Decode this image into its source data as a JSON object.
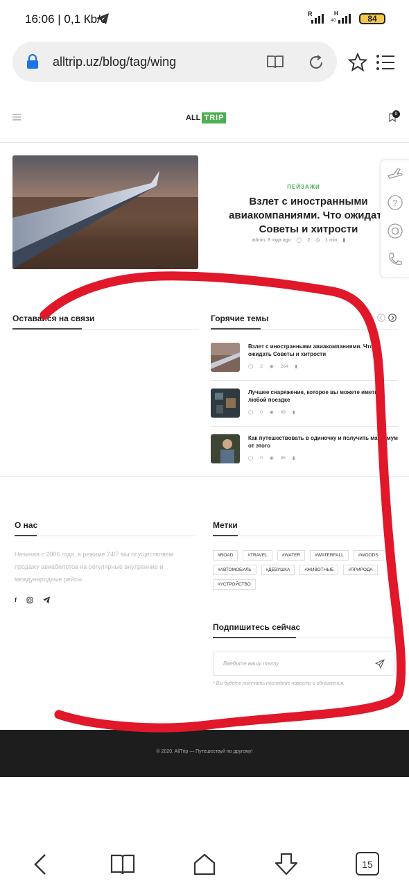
{
  "status": {
    "time": "16:06",
    "speed": "0,1 Кb/с",
    "battery": "84",
    "sim1": "R",
    "sim2": "H",
    "sim2_sub": "4G"
  },
  "browser": {
    "url": "alltrip.uz/blog/tag/wing",
    "tabs_count": "15"
  },
  "site": {
    "logo_all": "ALL",
    "logo_trip": "TRIP",
    "bookmark_count": "0",
    "featured": {
      "category": "ПЕЙЗАЖИ",
      "title": "Взлет с иностранными авиакомпаниями. Что ожидать Советы и хитрости",
      "author_time": "admin, 8 года ago",
      "comments": "2",
      "read_time": "1 min"
    },
    "keep_in_touch": "Оставайся на связи",
    "hot_topics": {
      "title": "Горячие темы",
      "posts": [
        {
          "title": "Взлет с иностранными авиакомпаниями. Что ожидать Советы и хитрости",
          "comments": "2",
          "views": "264"
        },
        {
          "title": "Лучшее снаряжение, которое вы можете иметь в любой поездке",
          "comments": "0",
          "views": "89"
        },
        {
          "title": "Как путешествовать в одиночку и получить максимум от этого",
          "comments": "0",
          "views": "95"
        }
      ]
    },
    "about": {
      "title": "О нас",
      "text": "Начиная с 2006 года, в режиме 24/7 мы осуществляем продажу авиабилетов на регулярные внутренние и международные рейсы."
    },
    "tags_title": "Метки",
    "tags": [
      "#ROAD",
      "#TRAVEL",
      "#WATER",
      "#WATERFALL",
      "#WOODS",
      "#АВТОМОБИЛЬ",
      "#ДЕВУШКА",
      "#ЖИВОТНЫЕ",
      "#ПРИРОДА",
      "#УСТРОЙСТВО"
    ],
    "subscribe": {
      "title": "Подпишитесь сейчас",
      "placeholder": "Введите вашу почту",
      "note": "* Вы будете получать последние новости и обновления."
    },
    "footer": "© 2020, AllTrip — Путешествуй по другому!"
  },
  "colors": {
    "accent": "#4caf50",
    "scribble": "#e0182a",
    "footer_bg": "#1d1d1d"
  }
}
